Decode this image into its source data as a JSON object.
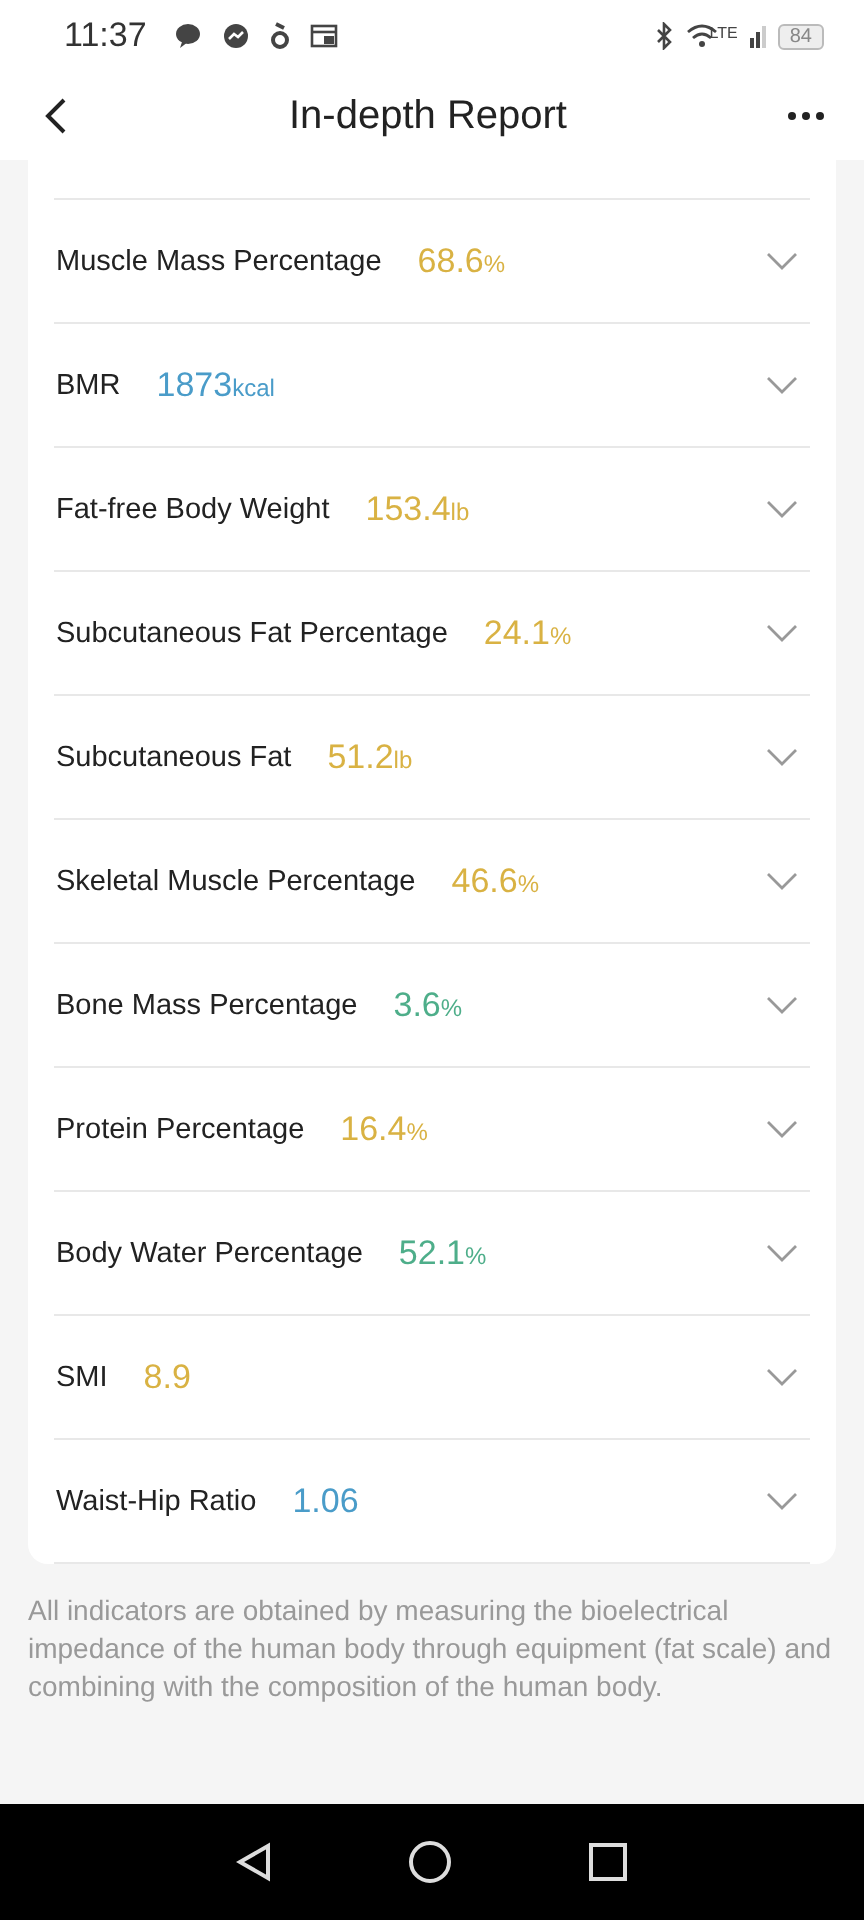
{
  "status_bar": {
    "time": "11:37",
    "network": "LTE",
    "battery": "84"
  },
  "header": {
    "title": "In-depth Report"
  },
  "metrics": [
    {
      "name": "Muscle Mass Percentage",
      "value": "68.6",
      "unit": "%",
      "color": "#d9b243",
      "expanded": false
    },
    {
      "name": "BMR",
      "value": "1873",
      "unit": "kcal",
      "color": "#4a9cc9",
      "expanded": false
    },
    {
      "name": "Fat-free Body Weight",
      "value": "153.4",
      "unit": "lb",
      "color": "#d9b243",
      "expanded": false
    },
    {
      "name": "Subcutaneous Fat Percentage",
      "value": "24.1",
      "unit": "%",
      "color": "#d9b243",
      "expanded": false
    },
    {
      "name": "Subcutaneous Fat",
      "value": "51.2",
      "unit": "lb",
      "color": "#d9b243",
      "expanded": false
    },
    {
      "name": "Skeletal Muscle Percentage",
      "value": "46.6",
      "unit": "%",
      "color": "#d9b243",
      "expanded": false
    },
    {
      "name": "Bone Mass Percentage",
      "value": "3.6",
      "unit": "%",
      "color": "#4eae8a",
      "expanded": false
    },
    {
      "name": "Protein Percentage",
      "value": "16.4",
      "unit": "%",
      "color": "#d9b243",
      "expanded": false
    },
    {
      "name": "Body Water Percentage",
      "value": "52.1",
      "unit": "%",
      "color": "#4eae8a",
      "expanded": false
    },
    {
      "name": "SMI",
      "value": "8.9",
      "color": "#d9b243",
      "expanded": false
    },
    {
      "name": "Waist-Hip Ratio",
      "value": "1.06",
      "color": "#4a9cc9",
      "expanded": false
    }
  ],
  "footnote": "All indicators are obtained by measuring the bioelectrical impedance of the human body through equipment (fat scale) and combining with the composition of the human body."
}
